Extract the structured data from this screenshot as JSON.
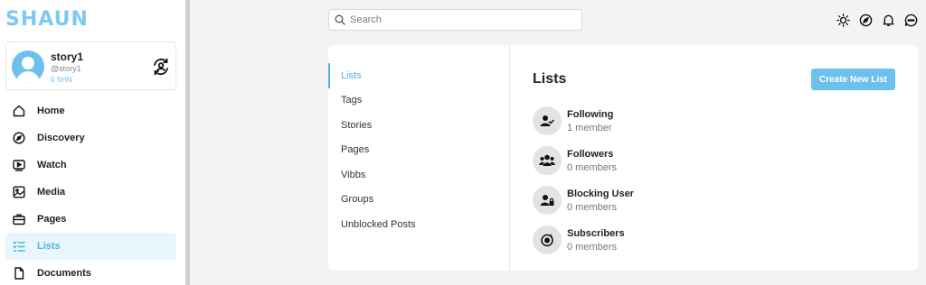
{
  "app": {
    "logo_text": "SHAUN",
    "accent_color": "#6ec0ec"
  },
  "profile": {
    "name": "story1",
    "handle": "@story1",
    "tokens": "0 SHN"
  },
  "sidebar": {
    "items": [
      {
        "label": "Home",
        "icon": "home-icon"
      },
      {
        "label": "Discovery",
        "icon": "compass-icon"
      },
      {
        "label": "Watch",
        "icon": "play-icon"
      },
      {
        "label": "Media",
        "icon": "image-icon"
      },
      {
        "label": "Pages",
        "icon": "briefcase-icon"
      },
      {
        "label": "Lists",
        "icon": "list-icon",
        "active": true
      },
      {
        "label": "Documents",
        "icon": "document-icon"
      }
    ]
  },
  "search": {
    "placeholder": "Search",
    "value": ""
  },
  "topbar": {
    "icons": [
      "sun-icon",
      "compass-icon",
      "bell-icon",
      "chat-icon"
    ]
  },
  "tabs": [
    {
      "label": "Lists",
      "active": true
    },
    {
      "label": "Tags"
    },
    {
      "label": "Stories"
    },
    {
      "label": "Pages"
    },
    {
      "label": "Vibbs"
    },
    {
      "label": "Groups"
    },
    {
      "label": "Unblocked Posts"
    }
  ],
  "main": {
    "title": "Lists",
    "create_button": "Create New List",
    "lists": [
      {
        "name": "Following",
        "count": "1 member",
        "icon": "user-check-icon"
      },
      {
        "name": "Followers",
        "count": "0 members",
        "icon": "users-icon"
      },
      {
        "name": "Blocking User",
        "count": "0 members",
        "icon": "user-lock-icon"
      },
      {
        "name": "Subscribers",
        "count": "0 members",
        "icon": "subscribe-icon"
      }
    ]
  }
}
